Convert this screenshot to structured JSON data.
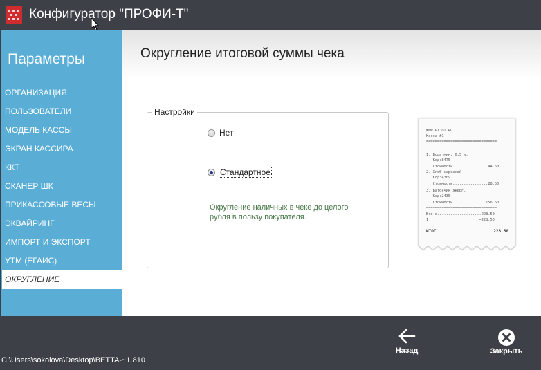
{
  "window": {
    "title": "Конфигуратор \"ПРОФИ-Т\""
  },
  "sidebar": {
    "heading": "Параметры",
    "items": [
      {
        "label": "ОРГАНИЗАЦИЯ",
        "active": false
      },
      {
        "label": "ПОЛЬЗОВАТЕЛИ",
        "active": false
      },
      {
        "label": "МОДЕЛЬ КАССЫ",
        "active": false
      },
      {
        "label": "ЭКРАН КАССИРА",
        "active": false
      },
      {
        "label": "ККТ",
        "active": false
      },
      {
        "label": "СКАНЕР ШК",
        "active": false
      },
      {
        "label": "ПРИКАССОВЫЕ ВЕСЫ",
        "active": false
      },
      {
        "label": "ЭКВАЙРИНГ",
        "active": false
      },
      {
        "label": "ИМПОРТ И ЭКСПОРТ",
        "active": false
      },
      {
        "label": "УТМ (ЕГАИС)",
        "active": false
      },
      {
        "label": "ОКРУГЛЕНИЕ",
        "active": true
      }
    ]
  },
  "main": {
    "title": "Округление итоговой суммы чека",
    "settings": {
      "legend": "Настройки",
      "options": [
        {
          "label": "Нет",
          "checked": false
        },
        {
          "label": "Стандартное",
          "checked": true
        }
      ],
      "description": "Округление наличных в чеке до целого рубля в пользу покупателя."
    },
    "receipt": {
      "lines": [
        "WWW.PI.OT RU",
        "Касса #1",
        "================================",
        "1. Вода мин. 0,5 л.",
        "   Код:8475",
        "   Стоимость................44.60",
        "2. Хлеб нарезной",
        "   Код:4309",
        "   Стоимость................28.50",
        "3. Батончик энерг.",
        "   Код:2435",
        "   Стоимость...............156.60",
        "================================",
        "Все-о....................228.50",
        "1                       =228.50"
      ],
      "total_label": "ИТОГ",
      "total_value": "228.50"
    }
  },
  "footer": {
    "back_label": "Назад",
    "close_label": "Закрыть"
  },
  "status": {
    "path": "C:\\Users\\sokolova\\Desktop\\BETTA-~1.810"
  },
  "icons": {
    "logo": "app-logo-icon",
    "back": "arrow-left-icon",
    "close": "close-circle-icon",
    "cursor": "mouse-cursor-icon"
  },
  "colors": {
    "titlebar": "#3d4147",
    "sidebar": "#5aaed6",
    "logo": "#cf2c2f",
    "description_text": "#4a7a4a",
    "radio_dot": "#2d3a8a"
  }
}
